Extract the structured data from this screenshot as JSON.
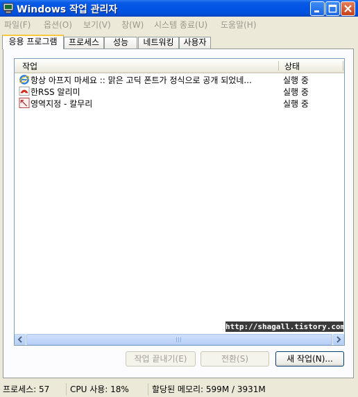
{
  "window": {
    "title": "Windows 작업 관리자"
  },
  "menu": [
    "파일(F)",
    "옵션(O)",
    "보기(V)",
    "창(W)",
    "시스템 종료(U)",
    "도움말(H)"
  ],
  "tabs": [
    "응용 프로그램",
    "프로세스",
    "성능",
    "네트워킹",
    "사용자"
  ],
  "list": {
    "columns": {
      "task": "작업",
      "status": "상태"
    },
    "rows": [
      {
        "task": "항상 아프지 마세요 :: 맑은 고딕 폰트가 정식으로 공개 되었네...",
        "status": "실행 중",
        "icon": "internet-explorer-icon"
      },
      {
        "task": "한RSS 알리미",
        "status": "실행 중",
        "icon": "rss-reader-icon"
      },
      {
        "task": "영역지정 - 칼무리",
        "status": "실행 중",
        "icon": "capture-tool-icon"
      }
    ]
  },
  "watermark": "http://shagall.tistory.com",
  "buttons": {
    "end_task": "작업 끝내기(E)",
    "switch_to": "전환(S)",
    "new_task": "새 작업(N)..."
  },
  "status": {
    "processes": "프로세스: 57",
    "cpu": "CPU 사용: 18%",
    "memory": "할당된 메모리: 599M / 3931M"
  },
  "colors": {
    "titlebar": "#0054e3",
    "window_bg": "#ece9d8",
    "tab_highlight": "#ffc73c"
  }
}
